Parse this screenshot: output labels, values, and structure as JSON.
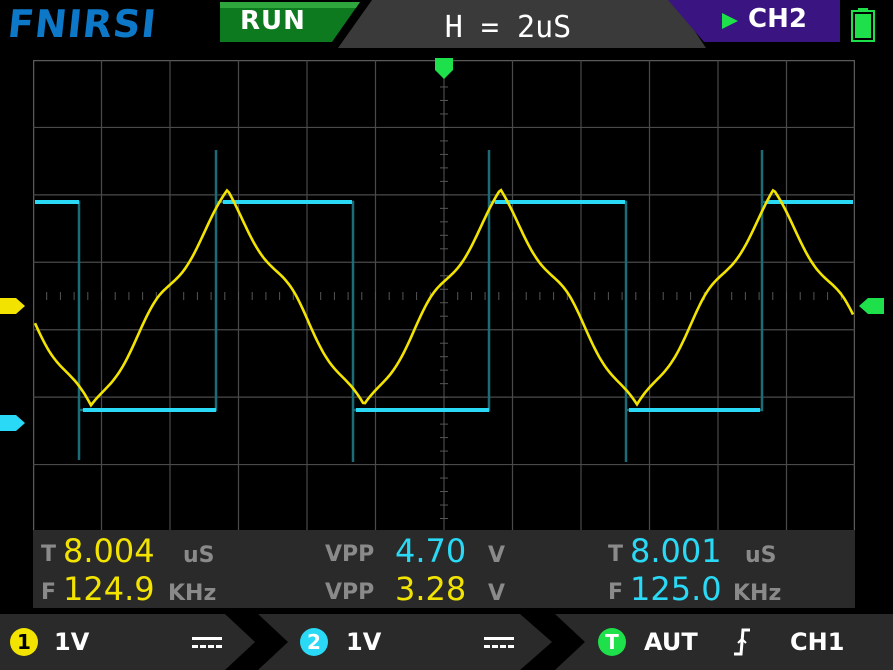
{
  "header": {
    "brand": "FNIRSI",
    "run_state": "RUN",
    "timebase": "H = 2uS",
    "trigger_channel": "CH2",
    "battery": "full"
  },
  "colors": {
    "ch1": "#f2e400",
    "ch2": "#29d9f5",
    "trigger": "#1ee04a",
    "brand": "#0d78c8"
  },
  "measurements": {
    "left": {
      "period_label": "T",
      "period_value": "8.004",
      "period_unit": "uS",
      "freq_label": "F",
      "freq_value": "124.9",
      "freq_unit": "KHz"
    },
    "center": {
      "vpp1_label": "VPP",
      "vpp1_value": "4.70",
      "vpp1_unit": "V",
      "vpp2_label": "VPP",
      "vpp2_value": "3.28",
      "vpp2_unit": "V"
    },
    "right": {
      "period_label": "T",
      "period_value": "8.001",
      "period_unit": "uS",
      "freq_label": "F",
      "freq_value": "125.0",
      "freq_unit": "KHz"
    }
  },
  "footer": {
    "ch1_num": "1",
    "ch1_scale": "1V",
    "ch1_coupling": "DC",
    "ch2_num": "2",
    "ch2_scale": "1V",
    "ch2_coupling": "DC",
    "trigger_icon": "T",
    "trigger_mode": "AUT",
    "trigger_edge": "rising",
    "trigger_source": "CH1"
  }
}
